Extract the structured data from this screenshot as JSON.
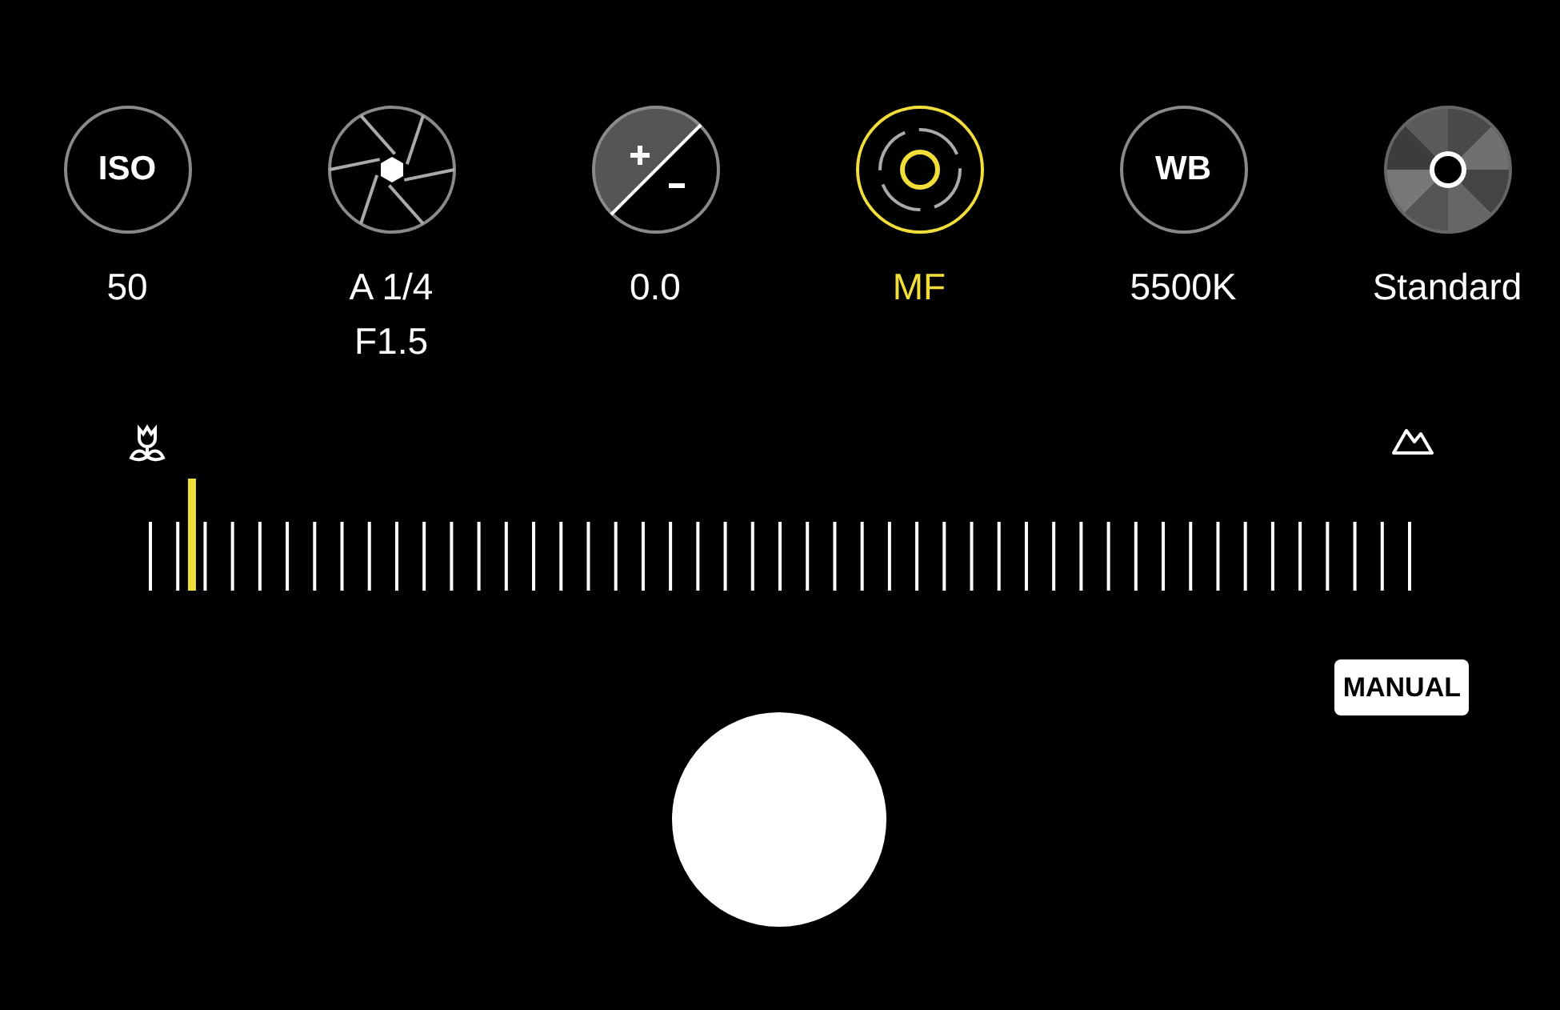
{
  "modes": [
    {
      "kind": "iso",
      "badge": "ISO",
      "value_lines": [
        "50"
      ],
      "selected": false
    },
    {
      "kind": "shutter",
      "value_lines": [
        "A 1/4",
        "F1.5"
      ],
      "selected": false
    },
    {
      "kind": "ev",
      "value_lines": [
        "0.0"
      ],
      "selected": false
    },
    {
      "kind": "focus",
      "value_lines": [
        "MF"
      ],
      "selected": true
    },
    {
      "kind": "wb",
      "badge": "WB",
      "value_lines": [
        "5500K"
      ],
      "selected": false
    },
    {
      "kind": "color",
      "value_lines": [
        "Standard"
      ],
      "selected": false
    }
  ],
  "focus_slider": {
    "level": 0.033
  },
  "mode_badge": "MANUAL"
}
